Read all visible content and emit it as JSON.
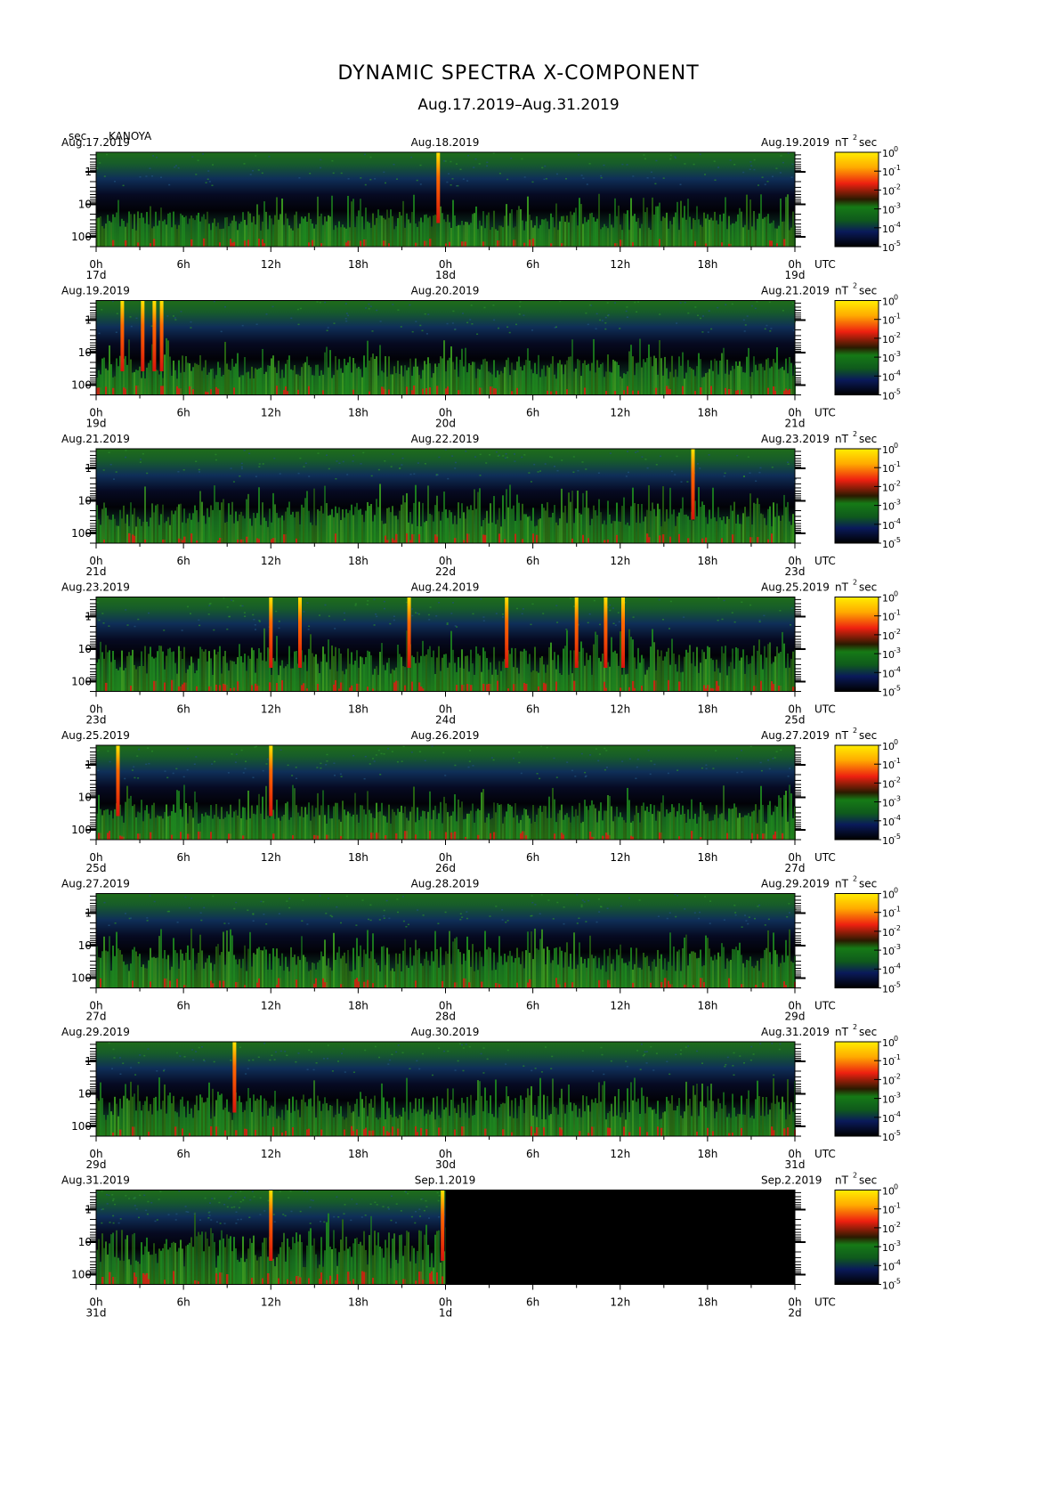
{
  "title": "DYNAMIC SPECTRA X-COMPONENT",
  "subtitle": "Aug.17.2019–Aug.31.2019",
  "y_unit": "sec",
  "station": "KANOYA",
  "colorbar_unit": "nT",
  "colorbar_unit_exp": "2",
  "colorbar_unit_suffix": "sec",
  "x_axis_label": "UTC",
  "colors": {
    "low": "#000000",
    "mid_low": "#0d1a6e",
    "mid": "#1c8a1c",
    "mid_high": "#e21e12",
    "high": "#ffe600"
  },
  "chart_data": {
    "type": "heatmap",
    "title": "DYNAMIC SPECTRA X-COMPONENT",
    "subtitle": "Aug.17.2019–Aug.31.2019",
    "ylabel": "sec",
    "y_scale": "log",
    "y_ticks": [
      "1",
      "10",
      "100"
    ],
    "x_ticks": [
      "0h",
      "6h",
      "12h",
      "18h",
      "0h",
      "6h",
      "12h",
      "18h",
      "0h"
    ],
    "colorbar_ticks": [
      "10",
      "10",
      "10",
      "10",
      "10",
      "10"
    ],
    "colorbar_exponents": [
      "0",
      "-1",
      "-2",
      "-3",
      "-4",
      "-5"
    ],
    "colorbar_label": "nT²sec",
    "panels": [
      {
        "left_date": "Aug.17.2019",
        "mid_date": "Aug.18.2019",
        "right_date": "Aug.19.2019",
        "day_labels": [
          "17d",
          "18d",
          "19d"
        ],
        "data_fraction": 1.0,
        "activity": 0.45,
        "events": [
          23.5
        ]
      },
      {
        "left_date": "Aug.19.2019",
        "mid_date": "Aug.20.2019",
        "right_date": "Aug.21.2019",
        "day_labels": [
          "19d",
          "20d",
          "21d"
        ],
        "data_fraction": 1.0,
        "activity": 0.55,
        "events": [
          1.8,
          3.2,
          4.0,
          4.5
        ]
      },
      {
        "left_date": "Aug.21.2019",
        "mid_date": "Aug.22.2019",
        "right_date": "Aug.23.2019",
        "day_labels": [
          "21d",
          "22d",
          "23d"
        ],
        "data_fraction": 1.0,
        "activity": 0.6,
        "events": [
          41.0
        ]
      },
      {
        "left_date": "Aug.23.2019",
        "mid_date": "Aug.24.2019",
        "right_date": "Aug.25.2019",
        "day_labels": [
          "23d",
          "24d",
          "25d"
        ],
        "data_fraction": 1.0,
        "activity": 0.7,
        "events": [
          12.0,
          14.0,
          21.5,
          28.2,
          33.0,
          35.0,
          36.2
        ]
      },
      {
        "left_date": "Aug.25.2019",
        "mid_date": "Aug.26.2019",
        "right_date": "Aug.27.2019",
        "day_labels": [
          "25d",
          "26d",
          "27d"
        ],
        "data_fraction": 1.0,
        "activity": 0.5,
        "events": [
          1.5,
          12.0
        ]
      },
      {
        "left_date": "Aug.27.2019",
        "mid_date": "Aug.28.2019",
        "right_date": "Aug.29.2019",
        "day_labels": [
          "27d",
          "28d",
          "29d"
        ],
        "data_fraction": 1.0,
        "activity": 0.6,
        "events": []
      },
      {
        "left_date": "Aug.29.2019",
        "mid_date": "Aug.30.2019",
        "right_date": "Aug.31.2019",
        "day_labels": [
          "29d",
          "30d",
          "31d"
        ],
        "data_fraction": 1.0,
        "activity": 0.6,
        "events": [
          9.5
        ]
      },
      {
        "left_date": "Aug.31.2019",
        "mid_date": "Sep.1.2019",
        "right_date": "Sep.2.2019",
        "day_labels": [
          "31d",
          "1d",
          "2d"
        ],
        "data_fraction": 0.5,
        "activity": 0.9,
        "events": [
          12.0,
          23.8
        ]
      }
    ]
  }
}
